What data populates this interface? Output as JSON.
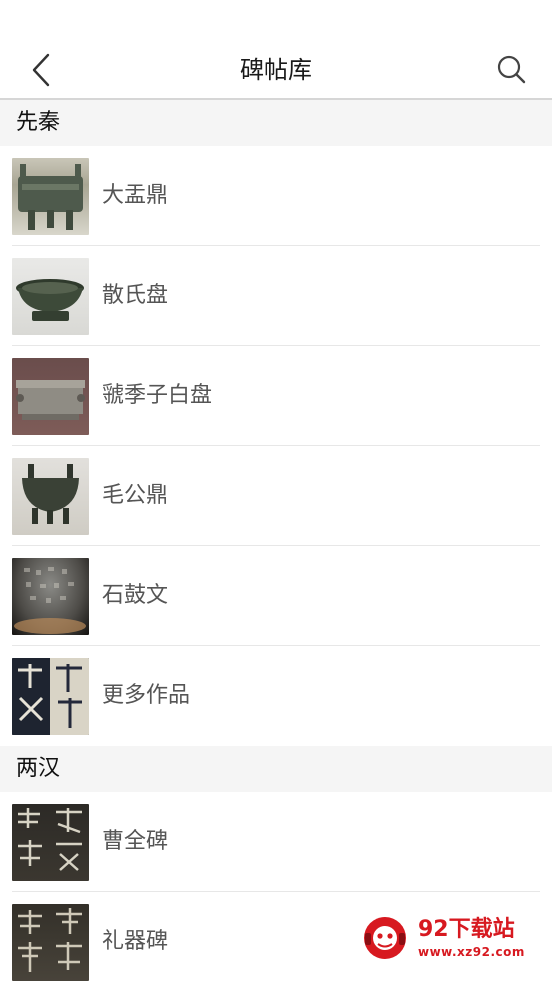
{
  "header": {
    "title": "碑帖库",
    "back_icon": "chevron-left-icon",
    "search_icon": "search-icon"
  },
  "sections": [
    {
      "title": "先秦",
      "items": [
        {
          "label": "大盂鼎"
        },
        {
          "label": "散氏盘"
        },
        {
          "label": "虢季子白盘"
        },
        {
          "label": "毛公鼎"
        },
        {
          "label": "石鼓文"
        },
        {
          "label": "更多作品"
        }
      ]
    },
    {
      "title": "两汉",
      "items": [
        {
          "label": "曹全碑"
        },
        {
          "label": "礼器碑"
        }
      ]
    }
  ],
  "watermark": {
    "title": "92下载站",
    "url": "www.xz92.com"
  }
}
